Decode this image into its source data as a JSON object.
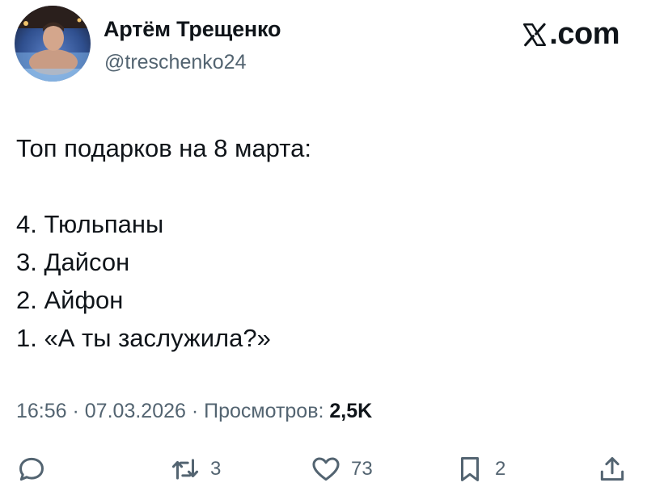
{
  "author": {
    "name": "Артём Трещенко",
    "handle": "@treschenko24"
  },
  "brand": {
    "label": ".com",
    "icon": "x-logo-icon"
  },
  "tweet": {
    "lines": [
      "Топ подарков на 8 марта:",
      "",
      "4. Тюльпаны",
      "3. Дайсон",
      "2. Айфон",
      "1. «А ты заслужила?»"
    ]
  },
  "meta": {
    "time": "16:56",
    "separator1": " · ",
    "date": "07.03.2026",
    "separator2": " · ",
    "views_label": "Просмотров: ",
    "views_count": "2,5K"
  },
  "actions": {
    "reply": {
      "icon": "reply-icon",
      "count": ""
    },
    "retweet": {
      "icon": "retweet-icon",
      "count": "3"
    },
    "like": {
      "icon": "heart-icon",
      "count": "73"
    },
    "bookmark": {
      "icon": "bookmark-icon",
      "count": "2"
    },
    "share": {
      "icon": "share-icon",
      "count": ""
    }
  },
  "colors": {
    "text": "#0f1419",
    "secondary": "#536471",
    "background": "#ffffff"
  }
}
